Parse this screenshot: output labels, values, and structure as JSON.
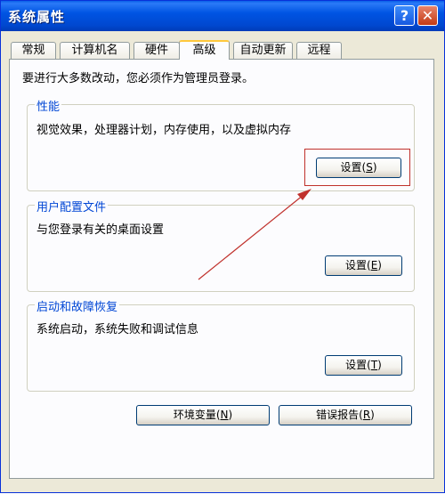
{
  "window": {
    "title": "系统属性",
    "help_glyph": "?",
    "close_glyph": "✕"
  },
  "tabs": [
    {
      "label": "常规"
    },
    {
      "label": "计算机名"
    },
    {
      "label": "硬件"
    },
    {
      "label": "高级",
      "active": true
    },
    {
      "label": "自动更新"
    },
    {
      "label": "远程"
    }
  ],
  "intro_text": "要进行大多数改动，您必须作为管理员登录。",
  "performance": {
    "title": "性能",
    "desc": "视觉效果，处理器计划，内存使用，以及虚拟内存",
    "button_text": "设置",
    "button_key": "S"
  },
  "user_profiles": {
    "title": "用户配置文件",
    "desc": "与您登录有关的桌面设置",
    "button_text": "设置",
    "button_key": "E"
  },
  "startup_recovery": {
    "title": "启动和故障恢复",
    "desc": "系统启动，系统失败和调试信息",
    "button_text": "设置",
    "button_key": "T"
  },
  "env_vars": {
    "button_text": "环境变量",
    "button_key": "N"
  },
  "error_report": {
    "button_text": "错误报告",
    "button_key": "R"
  },
  "annotation_color": "#c0312c"
}
